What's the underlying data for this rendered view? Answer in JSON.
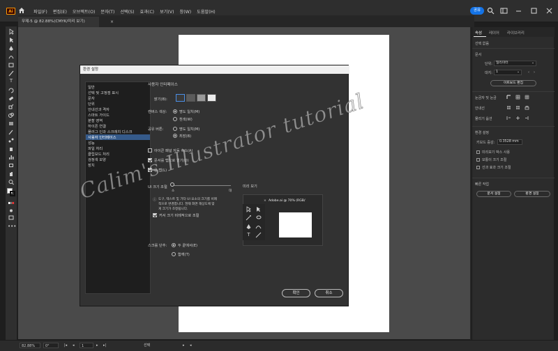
{
  "app": {
    "logo": "Ai",
    "menus": [
      "파일(F)",
      "편집(E)",
      "오브젝트(O)",
      "문자(T)",
      "선택(S)",
      "효과(C)",
      "보기(V)",
      "창(W)",
      "도움말(H)"
    ],
    "share_label": "공유"
  },
  "document_tab": {
    "title": "무제-5 @ 82.88%(CMYK/미리 보기)",
    "close": "×"
  },
  "properties_panel": {
    "tabs": [
      "속성",
      "레이어",
      "라이브러리"
    ],
    "no_selection": "선택 없음",
    "document_heading": "문서",
    "units_label": "단위:",
    "units_value": "밀리미터",
    "artboard_label": "대지:",
    "artboard_value": "1",
    "edit_artboard_button": "아트보드 편집",
    "rulers_grids_heading": "눈금자 및 눈금",
    "guides_heading": "안내선",
    "snap_heading": "물리기 옵션",
    "preferences_heading": "환경 설정",
    "keyboard_increment_label": "키보드 증감:",
    "keyboard_increment_value": "0.3528 mm",
    "pref_checks": [
      "미리보기 박스 사용",
      "모퉁이 크기 조절",
      "선과 효과 크기 조절"
    ],
    "quick_actions_heading": "빠른 작업",
    "document_setup_button": "문서 설정",
    "preferences_button": "환경 설정"
  },
  "status_bar": {
    "zoom": "82.88%",
    "rotation": "0°",
    "artboard_number": "1",
    "mode": "선택"
  },
  "dialog": {
    "title": "환경 설정",
    "nav_items": [
      "일반",
      "선택 및 고정점 표시",
      "문자",
      "단위",
      "안내선과 격자",
      "스마트 가이드",
      "분할 영역",
      "하이픈 연결",
      "플러그 인과 스크래치 디스크",
      "사용자 인터페이스",
      "성능",
      "파일 처리",
      "클립보드 처리",
      "검정색 모양",
      "장치"
    ],
    "selected_nav": "사용자 인터페이스",
    "section_title": "사용자 인터페이스",
    "brightness_label": "밝기(B):",
    "canvas_color_label": "캔버스 색상:",
    "canvas_color_options": [
      "명도 일치(M)",
      "흰색(W)"
    ],
    "share_button_label": "공유 버튼:",
    "share_button_options": [
      "명도 일치(M)",
      "최장(B)"
    ],
    "checkbox_auto_collapse": "아이콘 패널 자동 축소(A)",
    "checkbox_open_tabs": "문서를 탭으로 열기(O)",
    "checkbox_large_tabs": "큰 탭(L)",
    "ui_scale_label": "UI 크기 조절",
    "ui_scale_min": "소",
    "ui_scale_max": "대",
    "preview_label": "미리 보기",
    "preview_tab_title": "Adobe.ai @ 70% (RGB/",
    "ui_scale_note_1": "도구, 텍스트 및 기타 UI 요소의 크기를 비례",
    "ui_scale_note_2": "적으로 변경합니다. 현재 화면 해상도에 맞",
    "ui_scale_note_3": "게 크기가 조정됩니다.",
    "scale_cursor_label": "커서 크기 비례적으로 조절",
    "scroll_label": "스크롤 단추:",
    "scroll_options": [
      "두 끝에서(E)",
      "함께(T)"
    ],
    "ok_button": "확인",
    "cancel_button": "취소",
    "swatch_colors": [
      "#3a3a3a",
      "#5b5b5b",
      "#9a9a9a",
      "#ececec"
    ]
  },
  "watermark": "Calim's Illustrator tutorial"
}
